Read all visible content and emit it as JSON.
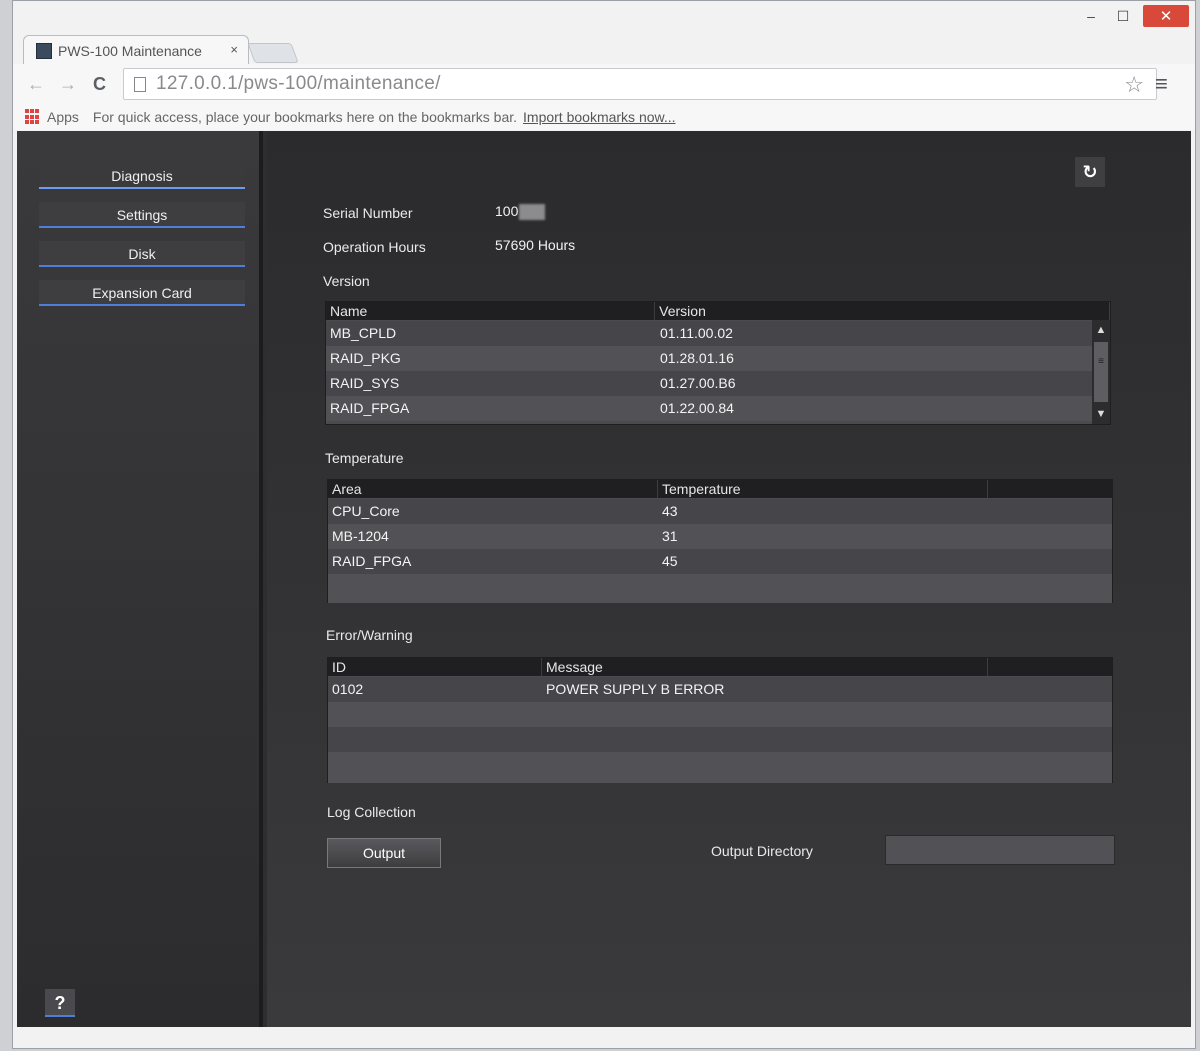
{
  "browser": {
    "tab_title": "PWS-100 Maintenance",
    "tab_close": "×",
    "url": "127.0.0.1/pws-100/maintenance/",
    "window_min": "–",
    "window_max": "☐",
    "window_close": "✕",
    "bookmarks": {
      "apps_label": "Apps",
      "hint": "For quick access, place your bookmarks here on the bookmarks bar.",
      "import_link": "Import bookmarks now..."
    }
  },
  "sidebar": {
    "items": [
      {
        "label": "Diagnosis"
      },
      {
        "label": "Settings"
      },
      {
        "label": "Disk"
      },
      {
        "label": "Expansion Card"
      }
    ],
    "help_label": "?"
  },
  "main": {
    "refresh_icon": "↻",
    "serial_number": {
      "label": "Serial Number",
      "value": "100"
    },
    "operation_hours": {
      "label": "Operation Hours",
      "value": "57690 Hours"
    },
    "version": {
      "title": "Version",
      "columns": [
        "Name",
        "Version"
      ],
      "rows": [
        {
          "name": "MB_CPLD",
          "version": "01.11.00.02"
        },
        {
          "name": "RAID_PKG",
          "version": "01.28.01.16"
        },
        {
          "name": "RAID_SYS",
          "version": "01.27.00.B6"
        },
        {
          "name": "RAID_FPGA",
          "version": "01.22.00.84"
        }
      ]
    },
    "temperature": {
      "title": "Temperature",
      "columns": [
        "Area",
        "Temperature"
      ],
      "rows": [
        {
          "area": "CPU_Core",
          "temperature": "43"
        },
        {
          "area": "MB-1204",
          "temperature": "31"
        },
        {
          "area": "RAID_FPGA",
          "temperature": "45"
        }
      ]
    },
    "error_warning": {
      "title": "Error/Warning",
      "columns": [
        "ID",
        "Message"
      ],
      "rows": [
        {
          "id": "0102",
          "message": "POWER SUPPLY B ERROR"
        }
      ]
    },
    "log_collection": {
      "title": "Log Collection",
      "output_label": "Output",
      "output_directory_label": "Output Directory",
      "output_directory_value": ""
    }
  }
}
